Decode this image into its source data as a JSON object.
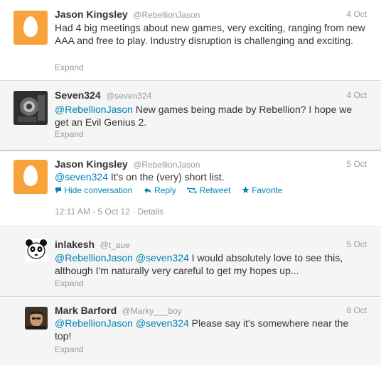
{
  "tweets": [
    {
      "fullname": "Jason Kingsley",
      "screenname": "@RebellionJason",
      "time": "4 Oct",
      "text": "Had 4 big meetings about new games, very exciting, ranging from new AAA and free to play. Industry disruption is challenging and exciting.",
      "expand": "Expand",
      "avatar": "egg-avatar"
    },
    {
      "fullname": "Seven324",
      "screenname": "@seven324",
      "time": "4 Oct",
      "mention": "@RebellionJason",
      "text_rest": " New games being made by Rebellion? I hope we get an Evil Genius 2.",
      "expand": "Expand",
      "avatar": "photo-avatar"
    },
    {
      "fullname": "Jason Kingsley",
      "screenname": "@RebellionJason",
      "time": "5 Oct",
      "mention": "@seven324",
      "text_rest": " It's on the (very) short list.",
      "actions": {
        "hide": "Hide conversation",
        "reply": "Reply",
        "retweet": "Retweet",
        "favorite": "Favorite"
      },
      "meta": "12:11 AM - 5 Oct 12 · Details",
      "avatar": "egg-avatar"
    },
    {
      "fullname": "inlakesh",
      "screenname": "@t_aue",
      "time": "5 Oct",
      "mention1": "@RebellionJason",
      "mention2": "@seven324",
      "text_rest": " I would absolutely love to see this, although I'm naturally very careful to get my hopes up...",
      "expand": "Expand",
      "avatar": "panda-avatar"
    },
    {
      "fullname": "Mark Barford",
      "screenname": "@Marky___boy",
      "time": "8 Oct",
      "mention1": "@RebellionJason",
      "mention2": "@seven324",
      "text_rest": " Please say it's somewhere near the top!",
      "expand": "Expand",
      "avatar": "photo-avatar"
    }
  ],
  "colors": {
    "link": "#0084b4",
    "egg_bg": "#f8a33a",
    "muted": "#999999"
  }
}
